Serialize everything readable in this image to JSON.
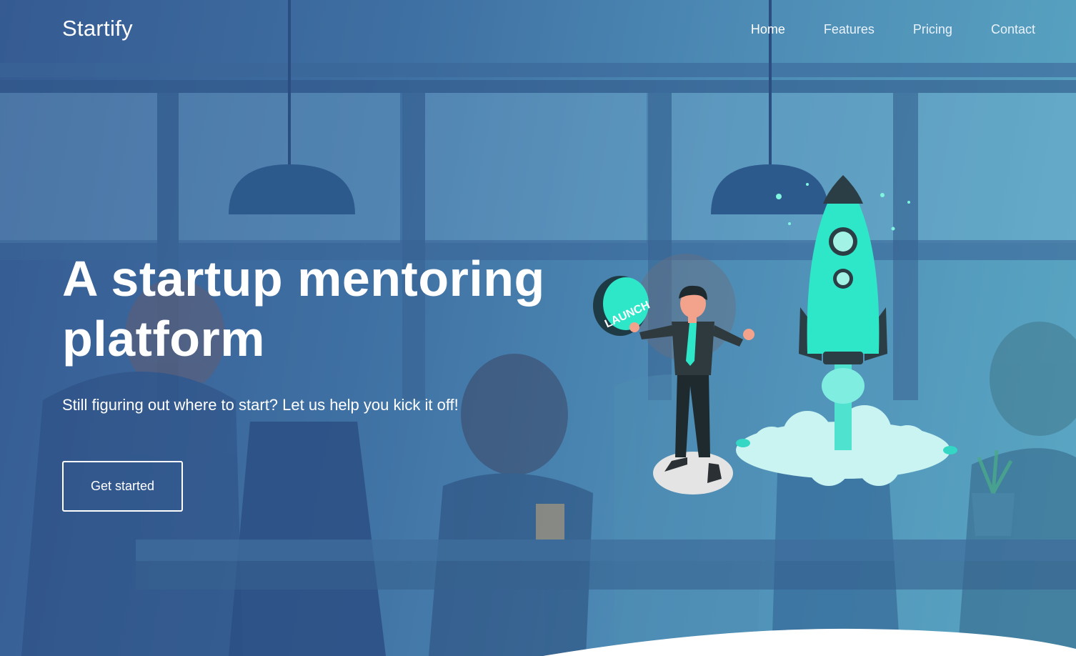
{
  "brand": {
    "name": "Startify"
  },
  "nav": {
    "items": [
      {
        "label": "Home",
        "active": true
      },
      {
        "label": "Features",
        "active": false
      },
      {
        "label": "Pricing",
        "active": false
      },
      {
        "label": "Contact",
        "active": false
      }
    ]
  },
  "hero": {
    "headline": "A startup mentoring platform",
    "subtitle": "Still figuring out where to start? Let us help you kick it off!",
    "cta_label": "Get started",
    "button_sign_text": "LAUNCH"
  },
  "colors": {
    "overlay_start": "#355b92",
    "overlay_end": "#5aa7c3",
    "accent_teal": "#2ee6c8",
    "text": "#ffffff"
  },
  "icons": [
    "rocket-icon",
    "launch-button-icon"
  ]
}
